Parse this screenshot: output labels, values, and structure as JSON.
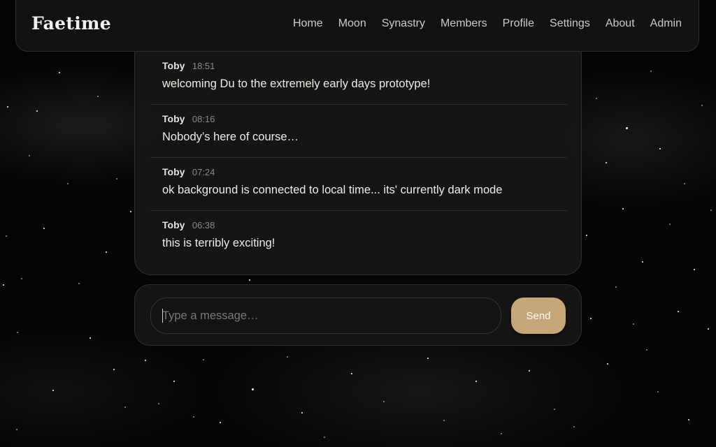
{
  "app": {
    "title": "Faetime"
  },
  "nav": {
    "items": [
      {
        "label": "Home"
      },
      {
        "label": "Moon"
      },
      {
        "label": "Synastry"
      },
      {
        "label": "Members"
      },
      {
        "label": "Profile"
      },
      {
        "label": "Settings"
      },
      {
        "label": "About"
      },
      {
        "label": "Admin"
      }
    ]
  },
  "messages": [
    {
      "author": "Toby",
      "time": "18:51",
      "text": "welcoming Du to the extremely early days prototype!"
    },
    {
      "author": "Toby",
      "time": "08:16",
      "text": "Nobody’s here of course…"
    },
    {
      "author": "Toby",
      "time": "07:24",
      "text": "ok background is connected to local time... its' currently dark mode"
    },
    {
      "author": "Toby",
      "time": "06:38",
      "text": "this is terribly exciting!"
    }
  ],
  "composer": {
    "value": "",
    "placeholder": "Type a message…",
    "send_label": "Send"
  },
  "colors": {
    "accent": "#c7a77a",
    "panel": "#161616",
    "background": "#050505"
  }
}
